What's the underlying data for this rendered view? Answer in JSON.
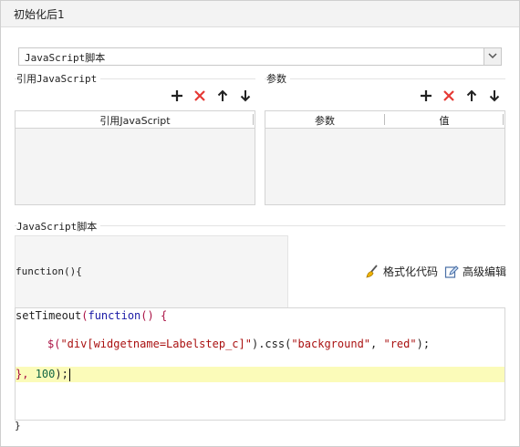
{
  "window": {
    "title": "初始化后1"
  },
  "script_type_select": {
    "value": "JavaScript脚本"
  },
  "ref_section": {
    "label": "引用JavaScript",
    "column_header": "引用JavaScript"
  },
  "param_section": {
    "label": "参数",
    "columns": [
      "参数",
      "值"
    ]
  },
  "script_section": {
    "label": "JavaScript脚本",
    "function_header": "function(){",
    "format_label": "格式化代码",
    "advanced_label": "高级编辑",
    "closing_brace": "}"
  },
  "code": {
    "line1": [
      "setTimeout",
      "(",
      "function",
      "() {"
    ],
    "line2": [
      "$(",
      "\"div[widgetname=Labelstep_c]\"",
      ").css(",
      "\"background\"",
      ", ",
      "\"red\"",
      ");"
    ],
    "line3": [
      "}, ",
      "100",
      ");"
    ]
  },
  "icons": {
    "add": "plus-icon",
    "delete": "cross-icon",
    "up": "arrow-up-icon",
    "down": "arrow-down-icon",
    "format": "broom-icon",
    "advanced": "edit-icon",
    "dropdown": "chevron-down-icon"
  },
  "colors": {
    "delete_icon": "#e53935",
    "highlight_line": "#fbfbb9",
    "keyword": "#1a1aa6",
    "string": "#aa1111"
  }
}
